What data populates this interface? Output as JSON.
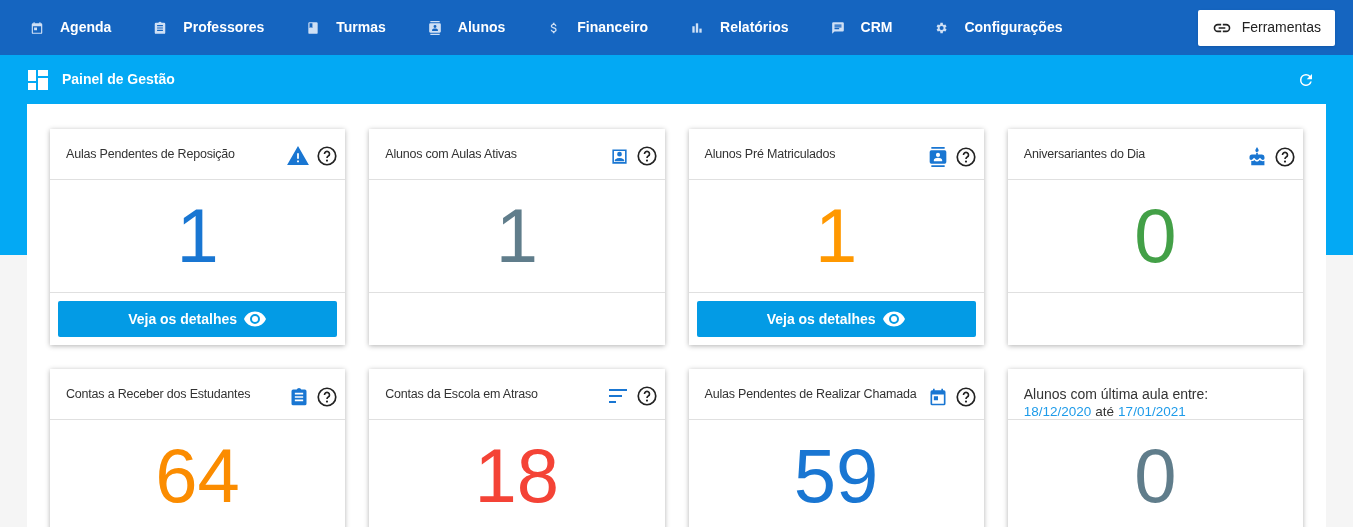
{
  "nav": {
    "items": [
      {
        "label": "Agenda"
      },
      {
        "label": "Professores"
      },
      {
        "label": "Turmas"
      },
      {
        "label": "Alunos"
      },
      {
        "label": "Financeiro"
      },
      {
        "label": "Relatórios"
      },
      {
        "label": "CRM"
      },
      {
        "label": "Configurações"
      }
    ],
    "tools_button": "Ferramentas"
  },
  "subheader": {
    "title": "Painel de Gestão"
  },
  "cards": [
    {
      "kind": "simple",
      "title": "Aulas Pendentes de Reposição",
      "value": "1",
      "color": "#1976d2",
      "button": "Veja os detalhes"
    },
    {
      "kind": "simple",
      "title": "Alunos com Aulas Ativas",
      "value": "1",
      "color": "#607d8b"
    },
    {
      "kind": "simple",
      "title": "Alunos Pré Matriculados",
      "value": "1",
      "color": "#ff9800",
      "button": "Veja os detalhes"
    },
    {
      "kind": "simple",
      "title": "Aniversariantes do Dia",
      "value": "0",
      "color": "#43a047"
    },
    {
      "kind": "simple",
      "title": "Contas a Receber dos Estudantes",
      "value": "64",
      "color": "#fb8c00"
    },
    {
      "kind": "simple",
      "title": "Contas da Escola em Atraso",
      "value": "18",
      "color": "#f44336"
    },
    {
      "kind": "simple",
      "title": "Aulas Pendentes de Realizar Chamada",
      "value": "59",
      "color": "#1976d2"
    },
    {
      "kind": "date_range",
      "title": "Alunos com última aula entre:",
      "date_from": "18/12/2020",
      "connector": "até",
      "date_to": "17/01/2021",
      "value": "0",
      "color": "#607d8b"
    }
  ]
}
